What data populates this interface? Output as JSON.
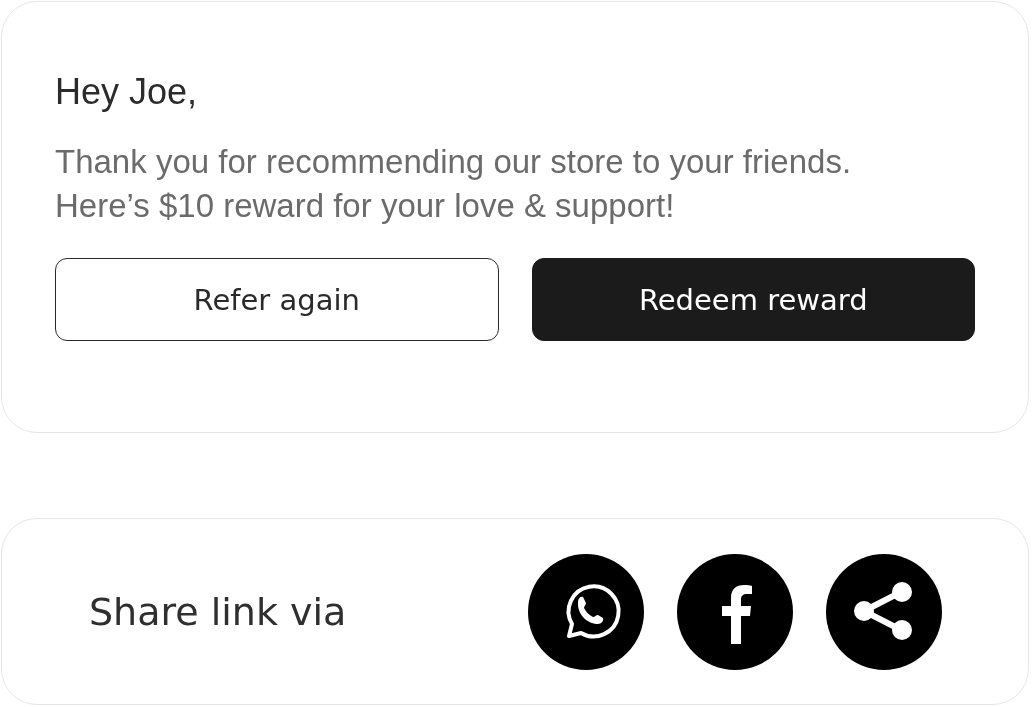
{
  "reward_card": {
    "greeting": "Hey Joe,",
    "message": "Thank you for recommending our store to your friends. Here’s $10 reward for your love & support!",
    "buttons": [
      {
        "label": "Refer again",
        "kind": "outline"
      },
      {
        "label": "Redeem reward",
        "kind": "filled"
      }
    ]
  },
  "share_card": {
    "label": "Share link via",
    "options": [
      {
        "kind": "whatsapp"
      },
      {
        "kind": "facebook"
      },
      {
        "kind": "share"
      }
    ]
  }
}
